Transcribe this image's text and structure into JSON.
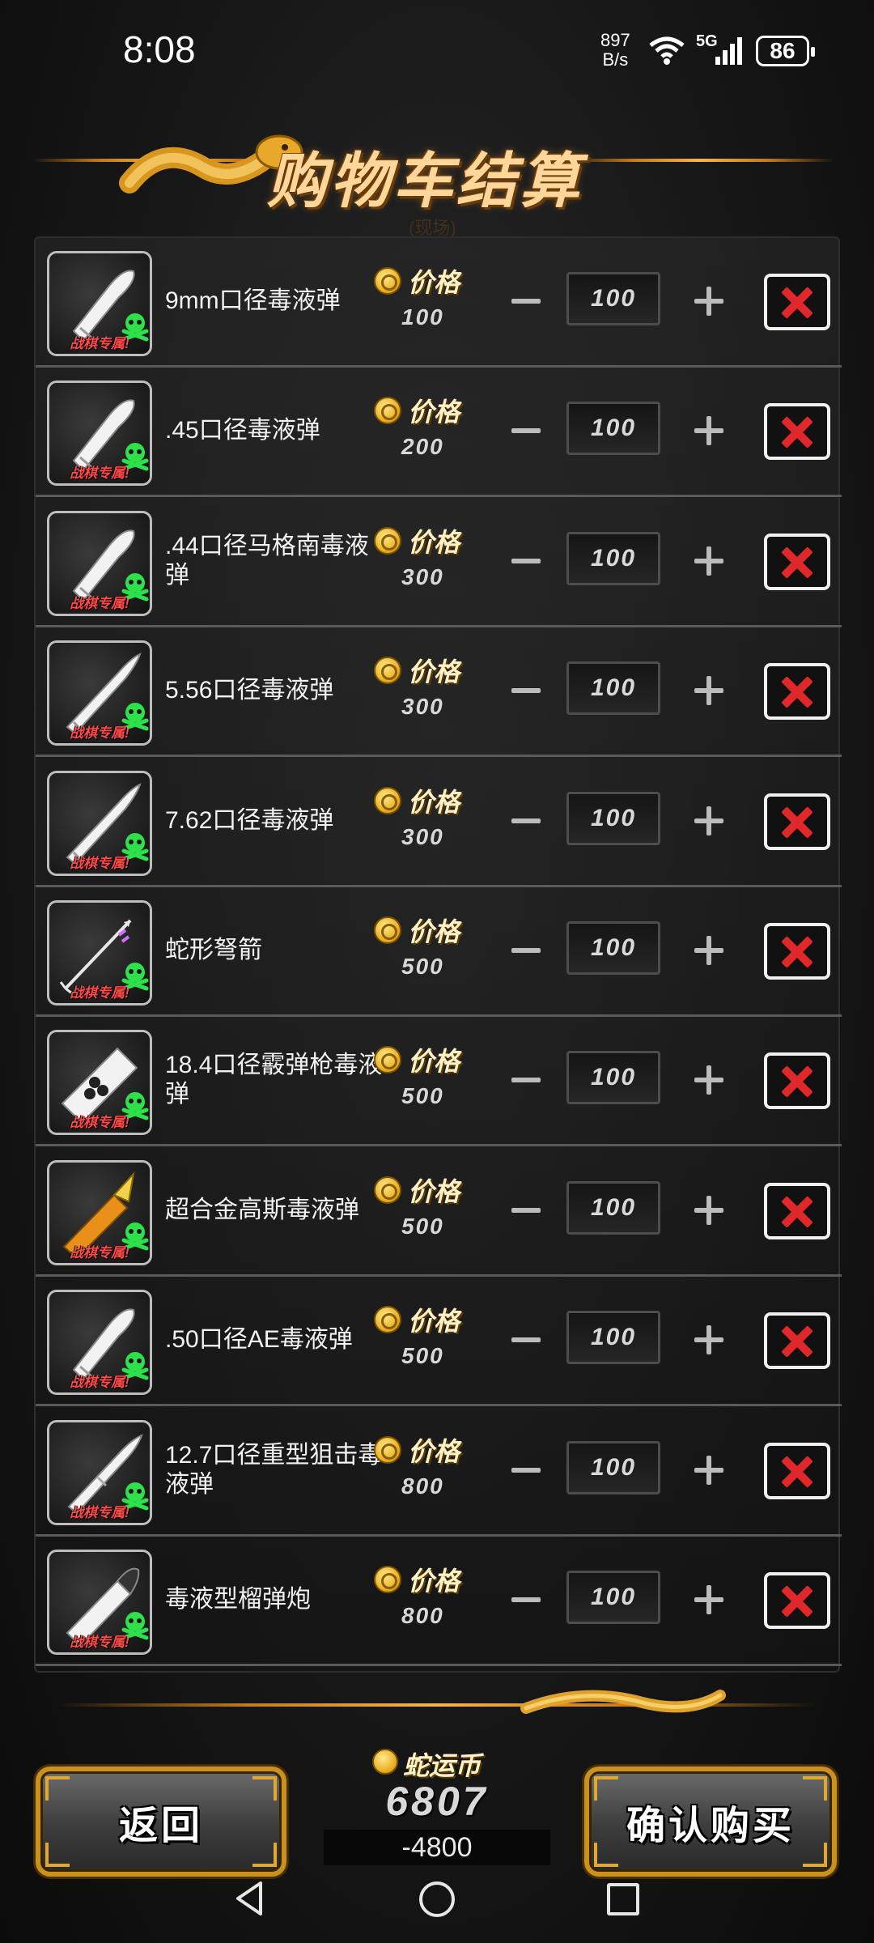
{
  "status_bar": {
    "time": "8:08",
    "net_speed_value": "897",
    "net_speed_unit": "B/s",
    "network": "5G",
    "battery": "86"
  },
  "header": {
    "title": "购物车结算",
    "subtitle": "(现场)"
  },
  "common": {
    "price_label": "价格",
    "exclusive_tag": "战棋专属!"
  },
  "cart": [
    {
      "name": "9mm口径毒液弹",
      "price": "100",
      "quantity": "100",
      "icon": "bullet-icon"
    },
    {
      "name": ".45口径毒液弹",
      "price": "200",
      "quantity": "100",
      "icon": "bullet-icon"
    },
    {
      "name": ".44口径马格南毒液弹",
      "price": "300",
      "quantity": "100",
      "icon": "bullet-icon"
    },
    {
      "name": "5.56口径毒液弹",
      "price": "300",
      "quantity": "100",
      "icon": "rifle-bullet-icon"
    },
    {
      "name": "7.62口径毒液弹",
      "price": "300",
      "quantity": "100",
      "icon": "rifle-bullet-icon"
    },
    {
      "name": "蛇形弩箭",
      "price": "500",
      "quantity": "100",
      "icon": "crossbow-bolt-icon"
    },
    {
      "name": "18.4口径霰弹枪毒液弹",
      "price": "500",
      "quantity": "100",
      "icon": "shotgun-shell-icon"
    },
    {
      "name": "超合金高斯毒液弹",
      "price": "500",
      "quantity": "100",
      "icon": "gauss-round-icon"
    },
    {
      "name": ".50口径AE毒液弹",
      "price": "500",
      "quantity": "100",
      "icon": "bullet-icon"
    },
    {
      "name": "12.7口径重型狙击毒液弹",
      "price": "800",
      "quantity": "100",
      "icon": "sniper-bullet-icon"
    },
    {
      "name": "毒液型榴弹炮",
      "price": "800",
      "quantity": "100",
      "icon": "grenade-round-icon"
    }
  ],
  "footer": {
    "back_label": "返回",
    "confirm_label": "确认购买",
    "currency_label": "蛇运币",
    "currency_amount": "6807",
    "currency_change": "-4800"
  },
  "colors": {
    "accent_gold": "#c9921e",
    "remove_red": "#e0282a",
    "tag_red": "#ff4a4a",
    "skull_green": "#2ee04a"
  }
}
